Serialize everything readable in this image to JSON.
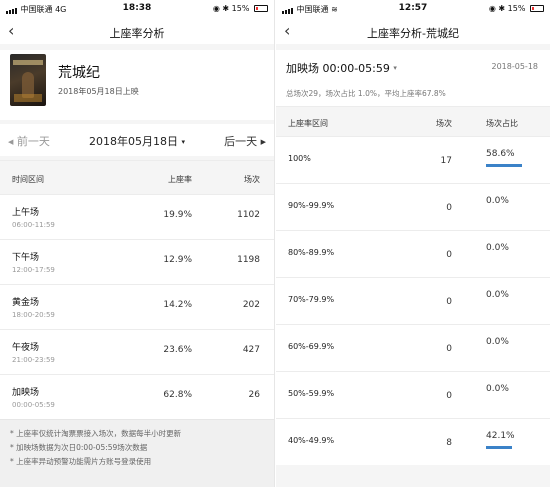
{
  "left": {
    "status": {
      "carrier": "中国联通",
      "network": "4G",
      "time": "18:38",
      "battery": "15%"
    },
    "nav": {
      "back": "‹",
      "title": "上座率分析"
    },
    "movie": {
      "name": "荒城纪",
      "release": "2018年05月18日上映"
    },
    "date_nav": {
      "prev": "前一天",
      "current": "2018年05月18日",
      "next": "后一天"
    },
    "table": {
      "headers": {
        "period": "时间区间",
        "rate": "上座率",
        "count": "场次"
      },
      "rows": [
        {
          "name": "上午场",
          "time": "06:00-11:59",
          "rate": "19.9%",
          "count": "1102"
        },
        {
          "name": "下午场",
          "time": "12:00-17:59",
          "rate": "12.9%",
          "count": "1198"
        },
        {
          "name": "黄金场",
          "time": "18:00-20:59",
          "rate": "14.2%",
          "count": "202"
        },
        {
          "name": "午夜场",
          "time": "21:00-23:59",
          "rate": "23.6%",
          "count": "427"
        },
        {
          "name": "加映场",
          "time": "00:00-05:59",
          "rate": "62.8%",
          "count": "26"
        }
      ]
    },
    "notes": [
      "* 上座率仅统计淘票票接入场次，数据每半小时更新",
      "* 加映场数据为次日0:00-05:59场次数据",
      "* 上座率异动预警功能需片方账号登录使用"
    ]
  },
  "right": {
    "status": {
      "carrier": "中国联通",
      "time": "12:57",
      "battery": "15%"
    },
    "nav": {
      "back": "‹",
      "title": "上座率分析-荒城纪"
    },
    "session": {
      "label": "加映场 00:00-05:59",
      "date": "2018-05-18"
    },
    "summary": "总场次29，场次占比 1.0%，平均上座率67.8%",
    "table": {
      "headers": {
        "range": "上座率区间",
        "count": "场次",
        "share": "场次占比"
      },
      "rows": [
        {
          "range": "100%",
          "count": "17",
          "share": "58.6%",
          "share_value": 0.586
        },
        {
          "range": "90%-99.9%",
          "count": "0",
          "share": "0.0%",
          "share_value": 0
        },
        {
          "range": "80%-89.9%",
          "count": "0",
          "share": "0.0%",
          "share_value": 0
        },
        {
          "range": "70%-79.9%",
          "count": "0",
          "share": "0.0%",
          "share_value": 0
        },
        {
          "range": "60%-69.9%",
          "count": "0",
          "share": "0.0%",
          "share_value": 0
        },
        {
          "range": "50%-59.9%",
          "count": "0",
          "share": "0.0%",
          "share_value": 0
        },
        {
          "range": "40%-49.9%",
          "count": "8",
          "share": "42.1%",
          "share_value": 0.421
        }
      ]
    },
    "accent_color": "#3b82c8"
  }
}
